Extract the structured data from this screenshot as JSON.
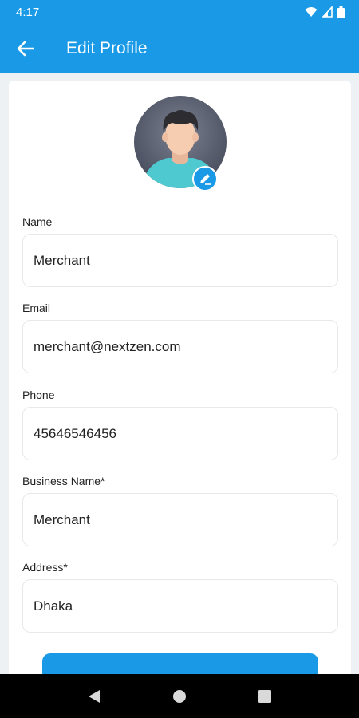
{
  "status_bar": {
    "time": "4:17",
    "icons": [
      "wifi-icon",
      "signal-icon",
      "battery-icon"
    ]
  },
  "app_bar": {
    "back_icon": "arrow-back-icon",
    "title": "Edit Profile"
  },
  "profile": {
    "avatar_icon": "person-avatar-icon",
    "edit_icon": "pencil-icon"
  },
  "form": {
    "name": {
      "label": "Name",
      "value": "Merchant"
    },
    "email": {
      "label": "Email",
      "value": "merchant@nextzen.com"
    },
    "phone": {
      "label": "Phone",
      "value": "45646546456"
    },
    "business_name": {
      "label": "Business Name*",
      "value": "Merchant"
    },
    "address": {
      "label": "Address*",
      "value": "Dhaka"
    }
  },
  "nav_bar": {
    "icons": [
      "back-triangle-icon",
      "home-circle-icon",
      "recents-square-icon"
    ]
  },
  "colors": {
    "primary": "#1a9ae6",
    "background": "#eef1f3",
    "card": "#ffffff",
    "nav": "#000000"
  }
}
